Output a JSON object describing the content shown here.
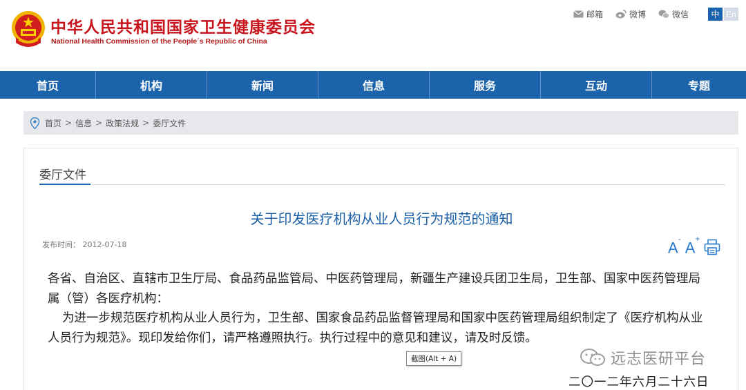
{
  "header": {
    "title": "中华人民共和国国家卫生健康委员会",
    "subtitle": "National Health Commission of the People´s Republic of China",
    "links": [
      {
        "label": "邮箱",
        "icon": "mail-icon"
      },
      {
        "label": "微博",
        "icon": "weibo-icon"
      },
      {
        "label": "微信",
        "icon": "wechat-icon"
      }
    ],
    "lang": {
      "zh": "中",
      "en": "En"
    }
  },
  "nav": {
    "items": [
      "首页",
      "机构",
      "新闻",
      "信息",
      "服务",
      "互动",
      "专题"
    ]
  },
  "breadcrumb": {
    "items": [
      "首页",
      "信息",
      "政策法规",
      "委厅文件"
    ],
    "separator": ">"
  },
  "section": {
    "title": "委厅文件"
  },
  "article": {
    "title": "关于印发医疗机构从业人员行为规范的通知",
    "date_label": "发布时间：",
    "date": "2012-07-18",
    "font_larger": "A",
    "font_smaller": "A",
    "salutation": "各省、自治区、直辖市卫生厅局、食品药品监管局、中医药管理局，新疆生产建设兵团卫生局，卫生部、国家中医药管理局属（管）各医疗机构：",
    "paragraph": "为进一步规范医疗机构从业人员行为，卫生部、国家食品药品监督管理局和国家中医药管理局组织制定了《医疗机构从业人员行为规范》。现印发给你们，请严格遵照执行。执行过程中的意见和建议，请及时反馈。",
    "sign_date": "二〇一二年六月二十六日"
  },
  "tooltip": "截图(Alt + A)",
  "watermark": "远志医研平台",
  "colors": {
    "nav_bg": "#1b64ac",
    "title_red": "#c8141c",
    "link_blue": "#1b5fa6"
  }
}
